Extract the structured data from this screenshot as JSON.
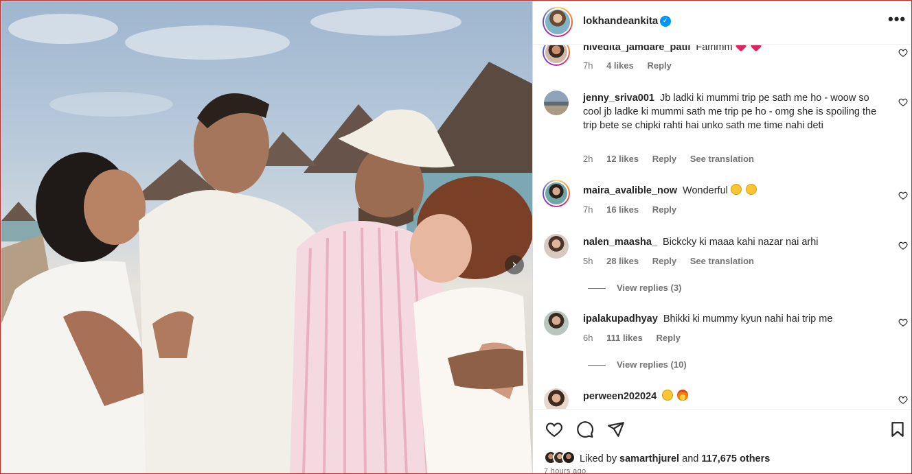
{
  "post": {
    "username": "lokhandeankita",
    "verified_mark": "✓",
    "more_label": "•••",
    "next_label": "›"
  },
  "comments": [
    {
      "user": "nivedita_jamdare_patil",
      "text": "Fammm",
      "emoji": [
        "heart",
        "heart"
      ],
      "time": "7h",
      "likes": "4 likes",
      "reply": "Reply",
      "ringed": true
    },
    {
      "user": "jenny_sriva001",
      "text": "Jb ladki ki mummi trip pe sath me ho - woow so cool jb ladke ki mummi sath me trip pe ho - omg she is spoiling the trip bete se chipki rahti hai unko sath me time nahi deti",
      "time": "2h",
      "likes": "12 likes",
      "reply": "Reply",
      "translation": "See translation"
    },
    {
      "user": "maira_avalible_now",
      "text": "Wonderful",
      "emoji": [
        "kiss-face",
        "kiss-face"
      ],
      "time": "7h",
      "likes": "16 likes",
      "reply": "Reply",
      "ringed": true
    },
    {
      "user": "nalen_maasha_",
      "text": "Bickcky ki maaa kahi nazar nai arhi",
      "time": "5h",
      "likes": "28 likes",
      "reply": "Reply",
      "translation": "See translation",
      "view_replies": "View replies (3)"
    },
    {
      "user": "ipalakupadhyay",
      "text": "Bhikki ki mummy kyun nahi hai trip me",
      "time": "6h",
      "likes": "111 likes",
      "reply": "Reply",
      "view_replies": "View replies (10)"
    },
    {
      "user": "perween202024",
      "text": "",
      "emoji": [
        "heart-eyes-face",
        "fire"
      ]
    }
  ],
  "likes_summary": {
    "prefix": "Liked by",
    "user": "samarthjurel",
    "middle": "and",
    "count": "117,675 others"
  },
  "timestamp": "7 hours ago",
  "colors": {
    "verified": "#0095f6",
    "meta_text": "#737373",
    "text": "#262626",
    "frame_border": "#c62828"
  },
  "icons": [
    "heart-icon",
    "comment-icon",
    "share-icon",
    "bookmark-icon",
    "more-options-icon",
    "carousel-next-icon"
  ]
}
